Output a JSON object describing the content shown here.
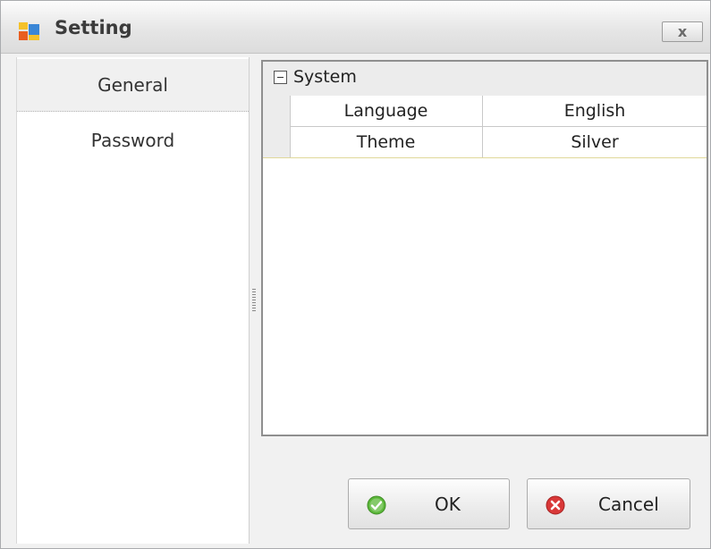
{
  "window": {
    "title": "Setting",
    "close_glyph": "x",
    "icon": "app-window-icon"
  },
  "nav": {
    "items": [
      {
        "label": "General",
        "selected": true
      },
      {
        "label": "Password",
        "selected": false
      }
    ]
  },
  "property_grid": {
    "category": "System",
    "rows": [
      {
        "name": "Language",
        "value": "English"
      },
      {
        "name": "Theme",
        "value": "Silver"
      }
    ]
  },
  "buttons": {
    "ok_label": "OK",
    "cancel_label": "Cancel"
  },
  "colors": {
    "ok_icon": "#5cb83a",
    "cancel_icon": "#d93838",
    "grid_border": "#8f8f8f"
  }
}
